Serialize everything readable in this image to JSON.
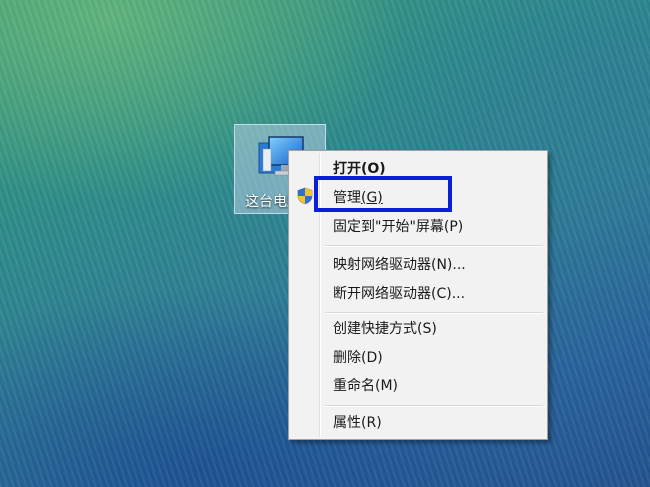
{
  "desktop": {
    "icon_label": "这台电脑"
  },
  "context_menu": {
    "items": [
      {
        "label": "打开",
        "shortcut": "(O)",
        "bold": true
      },
      {
        "label": "管理",
        "shortcut": "(G)",
        "icon": "uac-shield-icon",
        "highlighted": true
      },
      {
        "label": "固定到\"开始\"屏幕",
        "shortcut": "(P)"
      },
      {
        "label": "映射网络驱动器",
        "shortcut": "(N)..."
      },
      {
        "label": "断开网络驱动器",
        "shortcut": "(C)..."
      },
      {
        "label": "创建快捷方式",
        "shortcut": "(S)"
      },
      {
        "label": "删除",
        "shortcut": "(D)"
      },
      {
        "label": "重命名",
        "shortcut": "(M)"
      },
      {
        "label": "属性",
        "shortcut": "(R)"
      }
    ],
    "highlight_color": "#0a1fd8"
  }
}
